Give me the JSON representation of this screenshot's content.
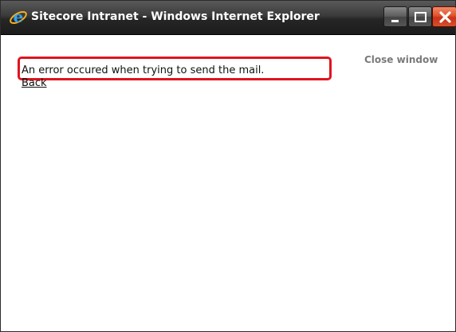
{
  "window": {
    "title": "Sitecore Intranet - Windows Internet Explorer",
    "app_icon": "internet-explorer-icon",
    "controls": {
      "minimize_icon": "minimize-icon",
      "maximize_icon": "maximize-icon",
      "close_icon": "close-icon"
    }
  },
  "page": {
    "close_window_label": "Close window",
    "error_message": "An error occured when trying to send the mail.",
    "back_label": "Back"
  },
  "colors": {
    "highlight_border": "#e0141e",
    "close_button": "#d8502a",
    "close_window_text": "#7a7a7a"
  }
}
